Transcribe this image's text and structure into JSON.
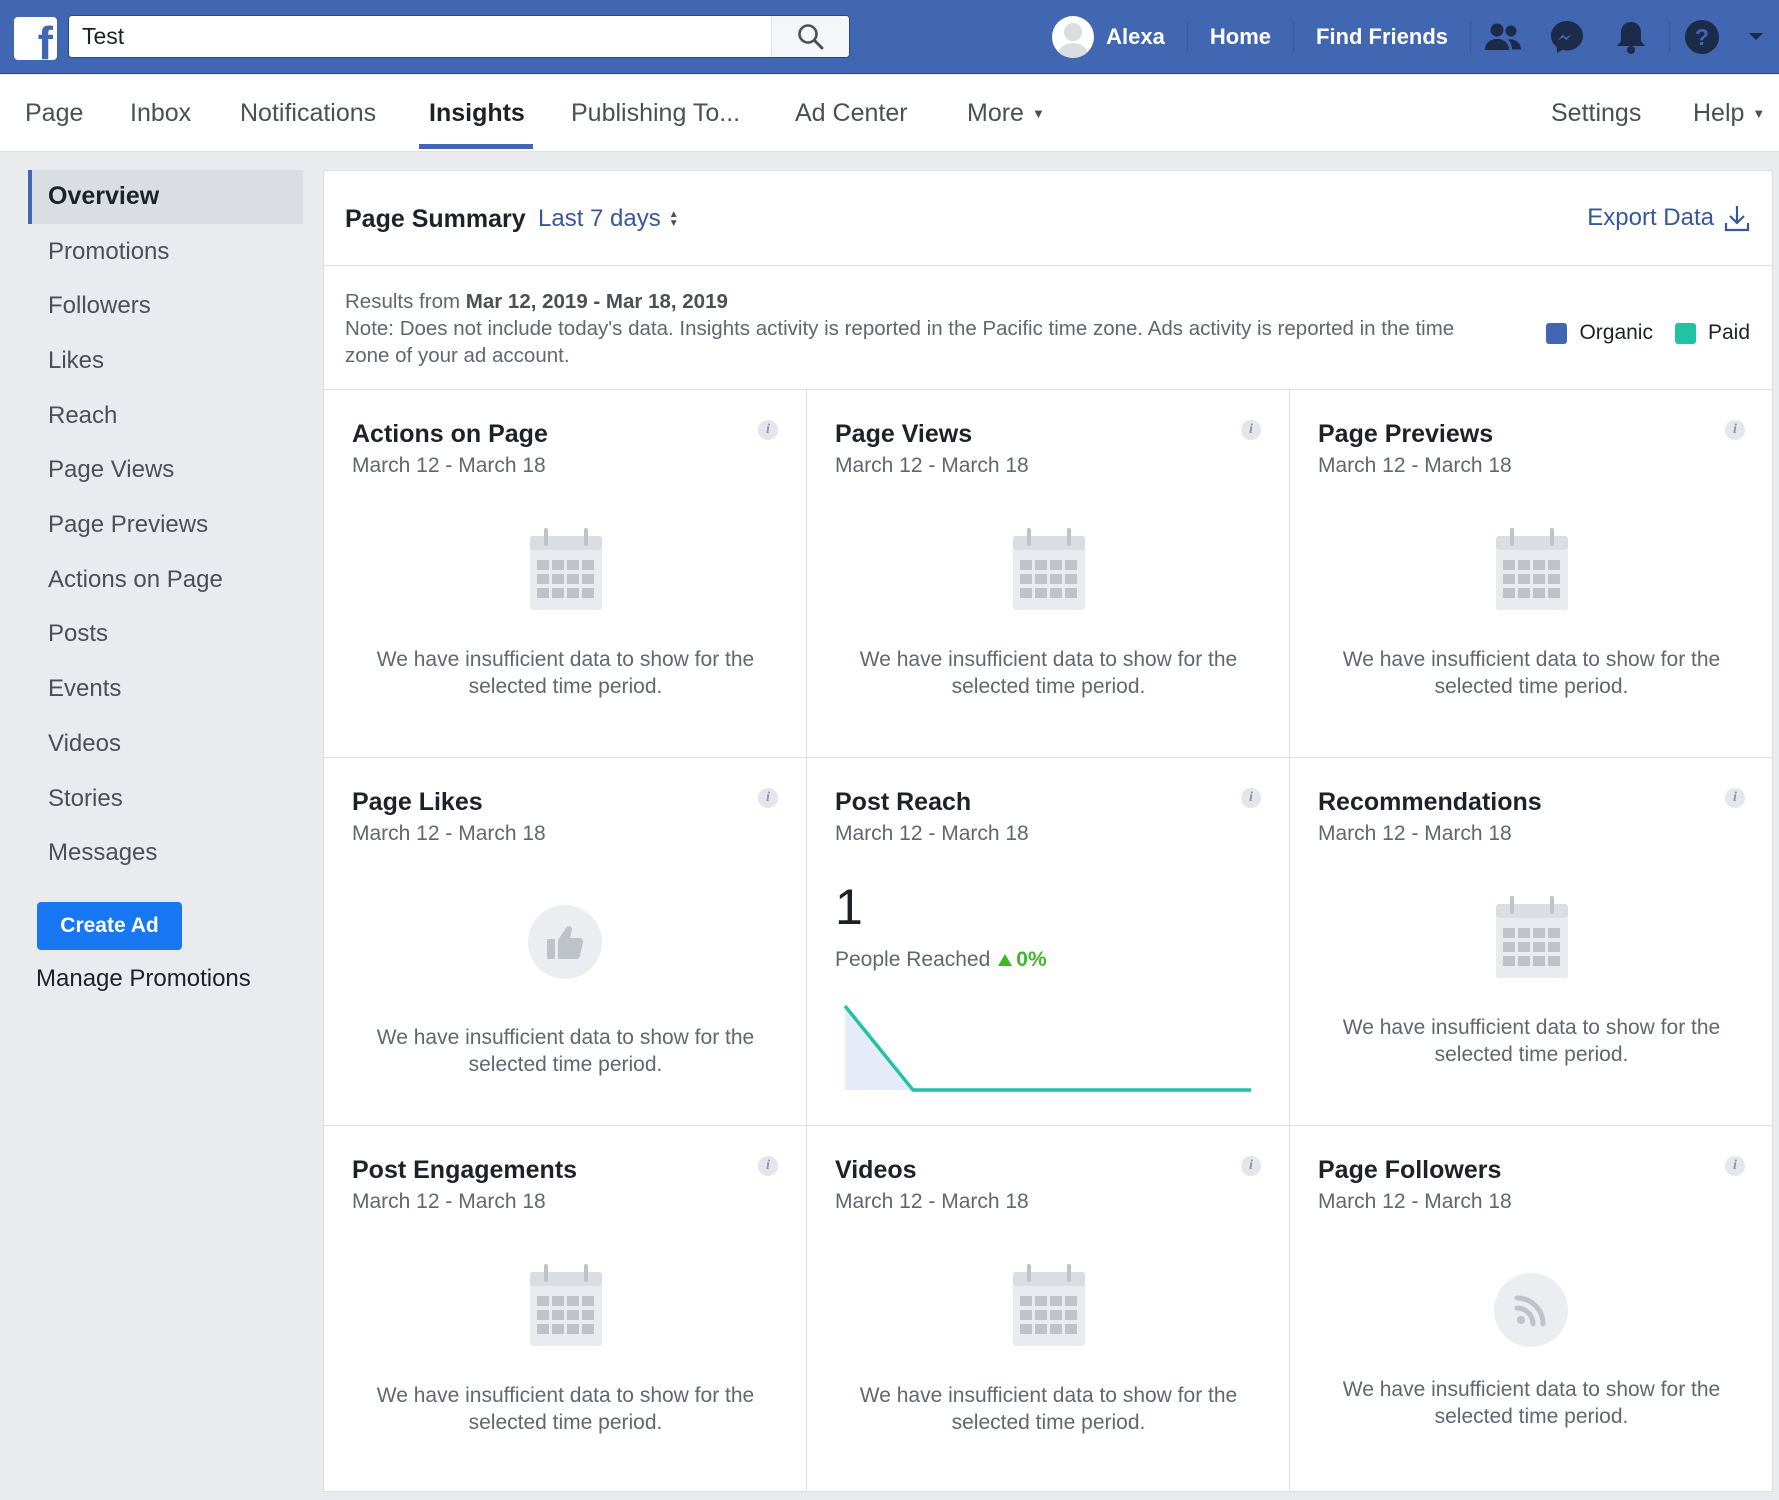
{
  "topbar": {
    "search_value": "Test",
    "user_name": "Alexa",
    "home": "Home",
    "find_friends": "Find Friends"
  },
  "pagenav": {
    "items": [
      "Page",
      "Inbox",
      "Notifications",
      "Insights",
      "Publishing To...",
      "Ad Center",
      "More"
    ],
    "active": "Insights",
    "settings": "Settings",
    "help": "Help"
  },
  "sidebar": {
    "items": [
      "Overview",
      "Promotions",
      "Followers",
      "Likes",
      "Reach",
      "Page Views",
      "Page Previews",
      "Actions on Page",
      "Posts",
      "Events",
      "Videos",
      "Stories",
      "Messages"
    ],
    "create_ad": "Create Ad",
    "manage_promotions": "Manage Promotions"
  },
  "summary": {
    "title": "Page Summary",
    "range": "Last 7 days",
    "export": "Export Data",
    "results_prefix": "Results from",
    "results_range": "Mar 12, 2019 - Mar 18, 2019",
    "note": "Note: Does not include today's data. Insights activity is reported in the Pacific time zone. Ads activity is reported in the time zone of your ad account.",
    "legend": [
      {
        "label": "Organic",
        "color": "#4267b2"
      },
      {
        "label": "Paid",
        "color": "#20c4a3"
      }
    ]
  },
  "cards": [
    {
      "title": "Actions on Page",
      "date": "March 12 - March 18",
      "icon": "calendar-icon",
      "message": "We have insufficient data to show for the selected time period."
    },
    {
      "title": "Page Views",
      "date": "March 12 - March 18",
      "icon": "calendar-icon",
      "message": "We have insufficient data to show for the selected time period."
    },
    {
      "title": "Page Previews",
      "date": "March 12 - March 18",
      "icon": "calendar-icon",
      "message": "We have insufficient data to show for the selected time period."
    },
    {
      "title": "Page Likes",
      "date": "March 12 - March 18",
      "icon": "thumbs-up-icon",
      "message": "We have insufficient data to show for the selected time period."
    },
    {
      "title": "Post Reach",
      "date": "March 12 - March 18",
      "value": "1",
      "value_label": "People Reached",
      "change": "0%"
    },
    {
      "title": "Recommendations",
      "date": "March 12 - March 18",
      "icon": "calendar-icon",
      "message": "We have insufficient data to show for the selected time period."
    },
    {
      "title": "Post Engagements",
      "date": "March 12 - March 18",
      "icon": "calendar-icon",
      "message": "We have insufficient data to show for the selected time period."
    },
    {
      "title": "Videos",
      "date": "March 12 - March 18",
      "icon": "calendar-icon",
      "message": "We have insufficient data to show for the selected time period."
    },
    {
      "title": "Page Followers",
      "date": "March 12 - March 18",
      "icon": "rss-icon",
      "message": "We have insufficient data to show for the selected time period."
    }
  ],
  "post_reach_sparkline": {
    "line_color": "#20c4a3",
    "fill_color": "#e6ebf9",
    "values": [
      1,
      0,
      0,
      0,
      0,
      0,
      0
    ]
  }
}
